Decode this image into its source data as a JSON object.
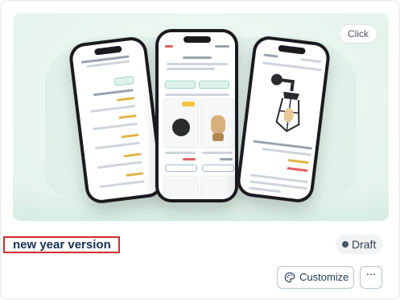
{
  "card": {
    "preview": {
      "click_label": "Click"
    },
    "title": "new year version",
    "status": {
      "label": "Draft",
      "dot_color": "#4b5563"
    },
    "actions": {
      "customize_label": "Customize",
      "more_label": "···"
    }
  },
  "colors": {
    "title_outline": "#d62b2b",
    "accent_green": "#9fd6c3"
  }
}
